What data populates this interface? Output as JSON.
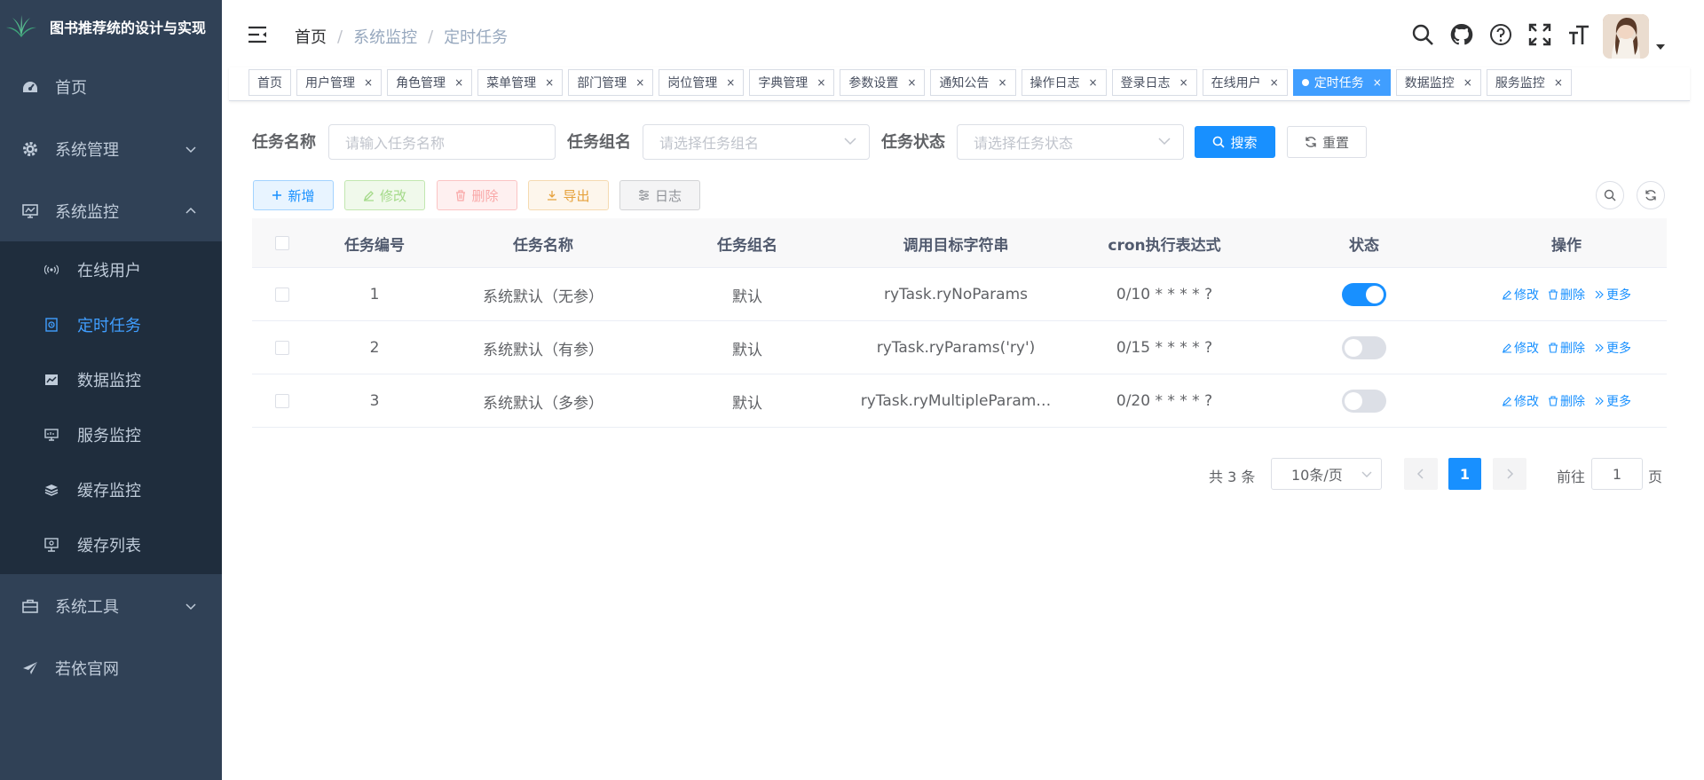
{
  "app": {
    "title": "图书推荐统的设计与实现"
  },
  "colors": {
    "sidebar_bg": "#304156",
    "submenu_bg": "#1f2d3d",
    "accent": "#1890ff",
    "active_menu_text": "#409eff"
  },
  "sidebar": {
    "items": [
      {
        "label": "首页",
        "icon": "dashboard-icon"
      },
      {
        "label": "系统管理",
        "icon": "gear-icon",
        "expanded": false
      },
      {
        "label": "系统监控",
        "icon": "monitor-icon",
        "expanded": true
      },
      {
        "label": "系统工具",
        "icon": "toolbox-icon",
        "expanded": false
      },
      {
        "label": "若依官网",
        "icon": "paper-plane-icon"
      }
    ],
    "submenu": [
      {
        "label": "在线用户",
        "icon": "online-icon"
      },
      {
        "label": "定时任务",
        "icon": "job-icon",
        "active": true
      },
      {
        "label": "数据监控",
        "icon": "druid-icon"
      },
      {
        "label": "服务监控",
        "icon": "server-icon"
      },
      {
        "label": "缓存监控",
        "icon": "redis-icon"
      },
      {
        "label": "缓存列表",
        "icon": "redis-list-icon"
      }
    ]
  },
  "breadcrumb": [
    "首页",
    "系统监控",
    "定时任务"
  ],
  "navbar_icons": [
    "search-icon",
    "github-icon",
    "question-icon",
    "fullscreen-icon",
    "font-size-icon"
  ],
  "tags": [
    {
      "label": "首页",
      "closable": false
    },
    {
      "label": "用户管理",
      "closable": true
    },
    {
      "label": "角色管理",
      "closable": true
    },
    {
      "label": "菜单管理",
      "closable": true
    },
    {
      "label": "部门管理",
      "closable": true
    },
    {
      "label": "岗位管理",
      "closable": true
    },
    {
      "label": "字典管理",
      "closable": true
    },
    {
      "label": "参数设置",
      "closable": true
    },
    {
      "label": "通知公告",
      "closable": true
    },
    {
      "label": "操作日志",
      "closable": true
    },
    {
      "label": "登录日志",
      "closable": true
    },
    {
      "label": "在线用户",
      "closable": true
    },
    {
      "label": "定时任务",
      "closable": true,
      "active": true
    },
    {
      "label": "数据监控",
      "closable": true
    },
    {
      "label": "服务监控",
      "closable": true
    }
  ],
  "tag_close": "×",
  "search": {
    "job_name_label": "任务名称",
    "job_name_placeholder": "请输入任务名称",
    "job_group_label": "任务组名",
    "job_group_placeholder": "请选择任务组名",
    "status_label": "任务状态",
    "status_placeholder": "请选择任务状态",
    "search_button": "搜索",
    "reset_button": "重置"
  },
  "toolbar": {
    "add": "新增",
    "edit": "修改",
    "delete": "删除",
    "export": "导出",
    "log": "日志"
  },
  "table": {
    "headers": [
      "任务编号",
      "任务名称",
      "任务组名",
      "调用目标字符串",
      "cron执行表达式",
      "状态",
      "操作"
    ],
    "rows": [
      {
        "id": "1",
        "name": "系统默认（无参）",
        "group": "默认",
        "target": "ryTask.ryNoParams",
        "cron": "0/10 * * * * ?",
        "status_on": true
      },
      {
        "id": "2",
        "name": "系统默认（有参）",
        "group": "默认",
        "target": "ryTask.ryParams('ry')",
        "cron": "0/15 * * * * ?",
        "status_on": false
      },
      {
        "id": "3",
        "name": "系统默认（多参）",
        "group": "默认",
        "target": "ryTask.ryMultipleParam…",
        "cron": "0/20 * * * * ?",
        "status_on": false
      }
    ],
    "row_actions": {
      "edit": "修改",
      "delete": "删除",
      "more": "更多"
    }
  },
  "pagination": {
    "total": "共 3 条",
    "page_size": "10条/页",
    "current_page": "1",
    "goto_prefix": "前往",
    "goto_value": "1",
    "goto_suffix": "页"
  }
}
